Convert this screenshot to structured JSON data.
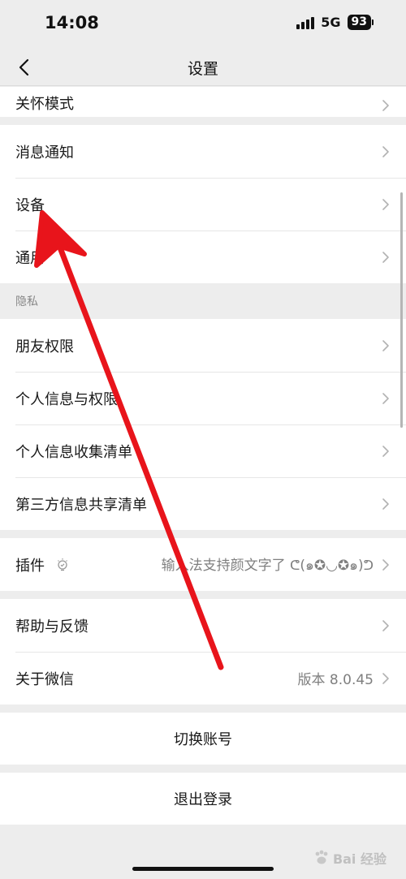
{
  "status_bar": {
    "time": "14:08",
    "network": "5G",
    "battery": "93"
  },
  "nav": {
    "title": "设置",
    "back_icon": "chevron-left-icon"
  },
  "group1": {
    "items": [
      {
        "label": "关怀模式"
      }
    ]
  },
  "group2": {
    "items": [
      {
        "label": "消息通知"
      },
      {
        "label": "设备"
      },
      {
        "label": "通用"
      }
    ]
  },
  "privacy": {
    "header": "隐私",
    "items": [
      {
        "label": "朋友权限"
      },
      {
        "label": "个人信息与权限"
      },
      {
        "label": "个人信息收集清单"
      },
      {
        "label": "第三方信息共享清单"
      }
    ]
  },
  "plugins": {
    "label": "插件",
    "icon": "bulb-icon",
    "value": "输入法支持颜文字了 ᕦ(๑✪◡✪๑)ᕤ"
  },
  "group5": {
    "items": [
      {
        "label": "帮助与反馈"
      },
      {
        "label": "关于微信",
        "value": "版本 8.0.45"
      }
    ]
  },
  "switch_account": {
    "label": "切换账号"
  },
  "logout": {
    "label": "退出登录"
  },
  "watermark": {
    "text": "Bai 经验"
  },
  "colors": {
    "background": "#ededed",
    "card": "#ffffff",
    "annotation_arrow": "#e8141b",
    "secondary_text": "#7f7f7f"
  }
}
